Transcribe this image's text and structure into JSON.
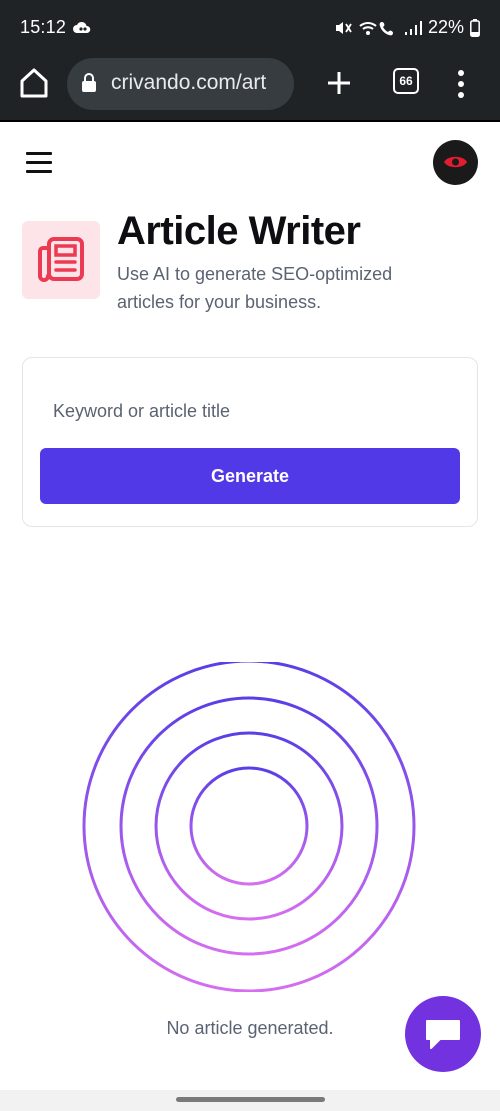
{
  "status_bar": {
    "time": "15:12",
    "battery": "22%",
    "icons": [
      "cloud-icon",
      "mute-icon",
      "wifi-call-icon",
      "signal-icon",
      "battery-icon"
    ]
  },
  "browser": {
    "url": "crivando.com/art",
    "tab_count": "66",
    "icons": [
      "home-icon",
      "lock-icon",
      "plus-icon",
      "tabs-icon",
      "more-vert-icon"
    ]
  },
  "header": {
    "menu_icon": "hamburger-icon",
    "avatar_icon": "eye-icon",
    "accent_color": "#e11d2f"
  },
  "tool": {
    "icon": "newspaper-icon",
    "title": "Article Writer",
    "subtitle": "Use AI to generate SEO-optimized articles for your business."
  },
  "form": {
    "input_placeholder": "Keyword or article title",
    "input_value": "",
    "button_label": "Generate",
    "button_color": "#5239e8"
  },
  "result": {
    "empty_text": "No article generated.",
    "illustration": "concentric-rings"
  },
  "chat": {
    "icon": "chat-bubble-icon",
    "color": "#7332e0"
  }
}
